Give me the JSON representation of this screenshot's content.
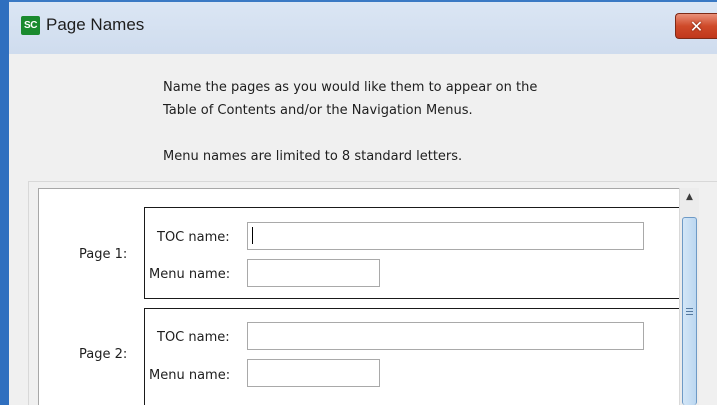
{
  "window": {
    "title": "Page Names",
    "app_icon_text": "SC",
    "close_glyph": "✕"
  },
  "instructions": {
    "line1": "Name the pages as you would like them to appear on the",
    "line2": "Table of Contents and/or the Navigation Menus.",
    "line3": "Menu names are limited to 8 standard letters."
  },
  "pages": [
    {
      "label": "Page 1:",
      "toc_label": "TOC name:",
      "toc_value": "",
      "menu_label": "Menu name:",
      "menu_value": ""
    },
    {
      "label": "Page 2:",
      "toc_label": "TOC name:",
      "toc_value": "",
      "menu_label": "Menu name:",
      "menu_value": ""
    }
  ],
  "scrollbar": {
    "up_glyph": "▲",
    "position_fraction": 0.0
  },
  "colors": {
    "close_button": "#c84225",
    "app_icon": "#1a8a2e",
    "window_frame": "#2f6fbf"
  }
}
